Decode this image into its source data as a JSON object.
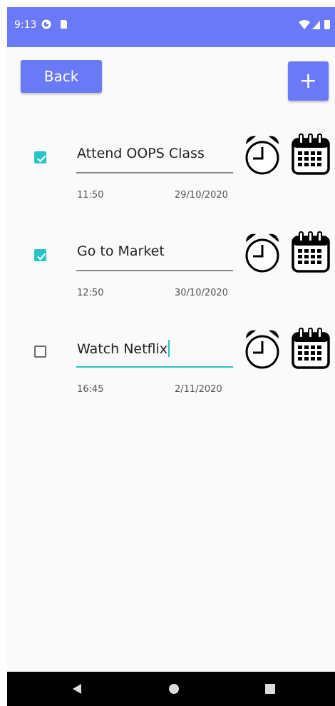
{
  "status_bar": {
    "time": "9:13",
    "color": "#6a79f5"
  },
  "toolbar": {
    "back_label": "Back",
    "add_label": "+"
  },
  "tasks": [
    {
      "title": "Attend OOPS Class",
      "time": "11:50",
      "date": "29/10/2020",
      "checked": true
    },
    {
      "title": "Go to Market",
      "time": "12:50",
      "date": "30/10/2020",
      "checked": true
    },
    {
      "title": "Watch Netflix",
      "time": "16:45",
      "date": "2/11/2020",
      "checked": false
    }
  ],
  "colors": {
    "accent": "#6a79f5",
    "check": "#26c6c6",
    "nav_bar": "#000000"
  },
  "icons": [
    "alarm-clock-icon",
    "calendar-icon",
    "nav-back-icon",
    "nav-home-icon",
    "nav-recents-icon"
  ]
}
